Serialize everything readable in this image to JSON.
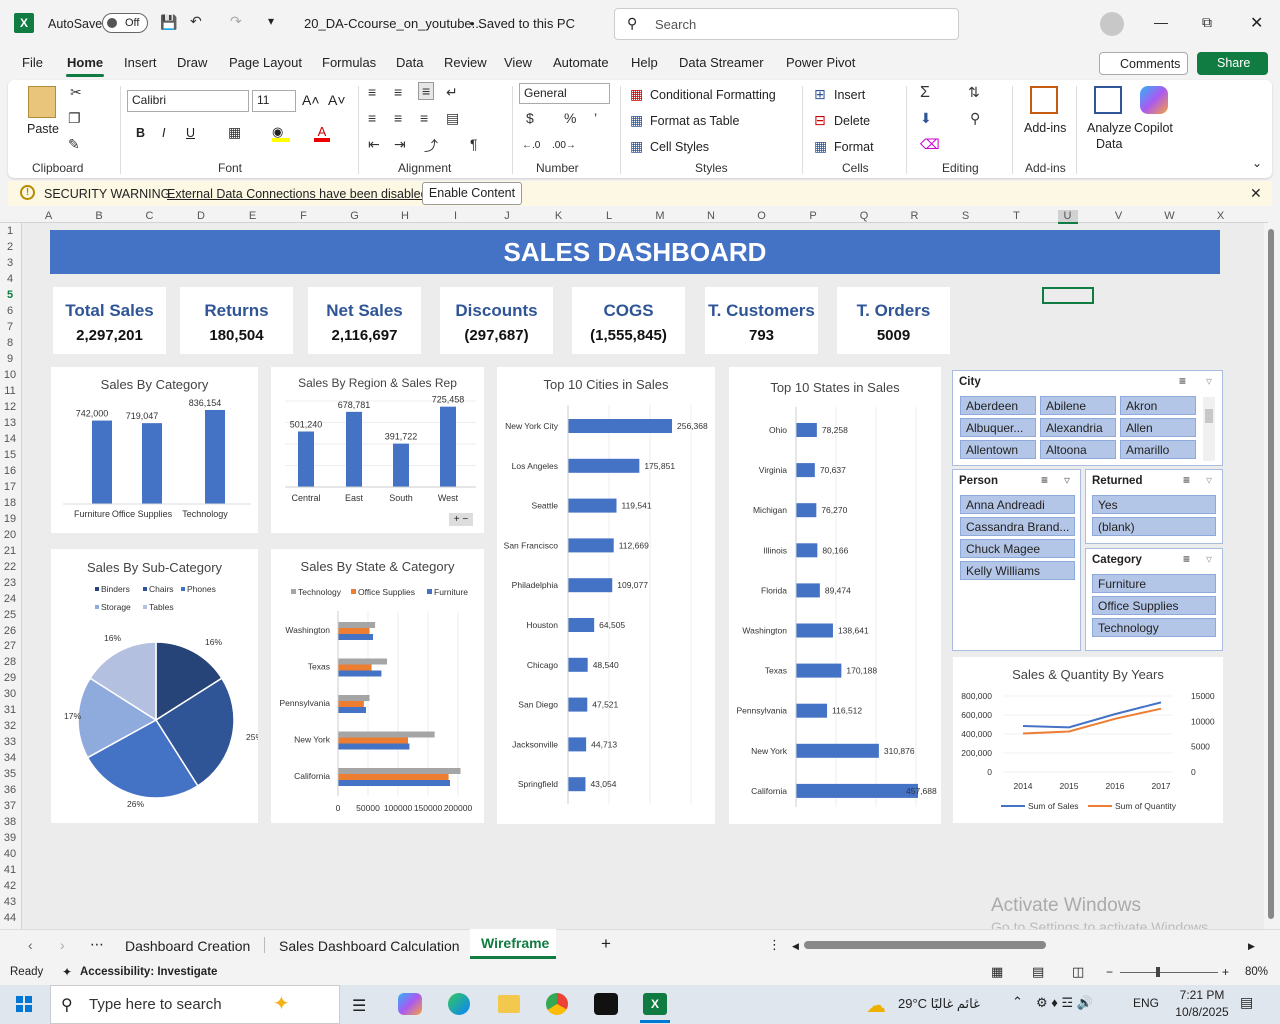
{
  "titlebar": {
    "autosave": "AutoSave",
    "toggle": "Off",
    "filename": "20_DA-Ccourse_on_youtube...",
    "saved": "• Saved to this PC",
    "search": "Search"
  },
  "menu": [
    "File",
    "Home",
    "Insert",
    "Draw",
    "Page Layout",
    "Formulas",
    "Data",
    "Review",
    "View",
    "Automate",
    "Help",
    "Data Streamer",
    "Power Pivot"
  ],
  "menu_right": {
    "comments": "Comments",
    "share": "Share"
  },
  "ribbon": {
    "paste": "Paste",
    "clipboard": "Clipboard",
    "font_name": "Calibri",
    "font_size": "11",
    "font": "Font",
    "alignment": "Alignment",
    "number_format": "General",
    "number": "Number",
    "cond_format": "Conditional Formatting",
    "format_table": "Format as Table",
    "cell_styles": "Cell Styles",
    "styles": "Styles",
    "insert": "Insert",
    "delete": "Delete",
    "format": "Format",
    "cells": "Cells",
    "editing": "Editing",
    "addins": "Add-ins",
    "addins_group": "Add-ins",
    "analyze": "Analyze",
    "analyze2": "Data",
    "copilot": "Copilot"
  },
  "security": {
    "title": "SECURITY WARNING",
    "msg": "External Data Connections have been disabled",
    "button": "Enable Content"
  },
  "columns": [
    "A",
    "B",
    "C",
    "D",
    "E",
    "F",
    "G",
    "H",
    "I",
    "J",
    "K",
    "L",
    "M",
    "N",
    "O",
    "P",
    "Q",
    "R",
    "S",
    "T",
    "U",
    "V",
    "W",
    "X"
  ],
  "rows": [
    "1",
    "2",
    "3",
    "4",
    "5",
    "6",
    "7",
    "8",
    "9",
    "10",
    "11",
    "12",
    "13",
    "14",
    "15",
    "16",
    "17",
    "18",
    "19",
    "20",
    "21",
    "22",
    "23",
    "24",
    "25",
    "26",
    "27",
    "28",
    "29",
    "30",
    "31",
    "32",
    "33",
    "34",
    "35",
    "36",
    "37",
    "38",
    "39",
    "40",
    "41",
    "42",
    "43",
    "44"
  ],
  "dashboard": {
    "title": "SALES DASHBOARD",
    "kpis": [
      {
        "label": "Total Sales",
        "value": "2,297,201"
      },
      {
        "label": "Returns",
        "value": "180,504"
      },
      {
        "label": "Net Sales",
        "value": "2,116,697"
      },
      {
        "label": "Discounts",
        "value": "(297,687)"
      },
      {
        "label": "COGS",
        "value": "(1,555,845)"
      },
      {
        "label": "T. Customers",
        "value": "793"
      },
      {
        "label": "T. Orders",
        "value": "5009"
      }
    ]
  },
  "slicers": {
    "city": {
      "title": "City",
      "items": [
        "Aberdeen",
        "Abilene",
        "Akron",
        "Albuquer...",
        "Alexandria",
        "Allen",
        "Allentown",
        "Altoona",
        "Amarillo"
      ]
    },
    "person": {
      "title": "Person",
      "items": [
        "Anna Andreadi",
        "Cassandra Brand...",
        "Chuck Magee",
        "Kelly Williams"
      ]
    },
    "returned": {
      "title": "Returned",
      "items": [
        "Yes",
        "(blank)"
      ]
    },
    "category": {
      "title": "Category",
      "items": [
        "Furniture",
        "Office Supplies",
        "Technology"
      ]
    }
  },
  "chart_data": [
    {
      "type": "bar",
      "title": "Sales By Category",
      "categories": [
        "Furniture",
        "Office Supplies",
        "Technology"
      ],
      "values": [
        742000,
        719047,
        836154
      ],
      "labels": [
        "742,000",
        "719,047",
        "836,154"
      ]
    },
    {
      "type": "bar",
      "title": "Sales By Region & Sales Rep",
      "categories": [
        "Central",
        "East",
        "South",
        "West"
      ],
      "values": [
        501240,
        678781,
        391722,
        725458
      ],
      "labels": [
        "501,240",
        "678,781",
        "391,722",
        "725,458"
      ]
    },
    {
      "type": "bar",
      "title": "Top 10 Cities in Sales",
      "categories": [
        "New York City",
        "Los Angeles",
        "Seattle",
        "San Francisco",
        "Philadelphia",
        "Houston",
        "Chicago",
        "San Diego",
        "Jacksonville",
        "Springfield"
      ],
      "values": [
        256368,
        175851,
        119541,
        112669,
        109077,
        64505,
        48540,
        47521,
        44713,
        43054
      ],
      "labels": [
        "256,368",
        "175,851",
        "119,541",
        "112,669",
        "109,077",
        "64,505",
        "48,540",
        "47,521",
        "44,713",
        "43,054"
      ]
    },
    {
      "type": "bar",
      "title": "Top 10 States in Sales",
      "categories": [
        "Ohio",
        "Virginia",
        "Michigan",
        "Illinois",
        "Florida",
        "Washington",
        "Texas",
        "Pennsylvania",
        "New York",
        "California"
      ],
      "values": [
        78258,
        70637,
        76270,
        80166,
        89474,
        138641,
        170188,
        116512,
        310876,
        457688
      ],
      "labels": [
        "78,258",
        "70,637",
        "76,270",
        "80,166",
        "89,474",
        "138,641",
        "170,188",
        "116,512",
        "310,876",
        "457,688"
      ]
    },
    {
      "type": "pie",
      "title": "Sales By Sub-Category",
      "categories": [
        "Binders",
        "Chairs",
        "Phones",
        "Storage",
        "Tables"
      ],
      "values": [
        16,
        25,
        26,
        17,
        16
      ],
      "labels": [
        "16%",
        "25%",
        "26%",
        "17%",
        "16%"
      ]
    },
    {
      "type": "bar",
      "title": "Sales By State & Category",
      "categories": [
        "Washington",
        "Texas",
        "Pennsylvania",
        "New York",
        "California"
      ],
      "series": [
        {
          "name": "Technology",
          "values": [
            53000,
            70000,
            45000,
            138000,
            175000
          ]
        },
        {
          "name": "Office Supplies",
          "values": [
            45000,
            48000,
            37000,
            100000,
            158000
          ]
        },
        {
          "name": "Furniture",
          "values": [
            50000,
            62000,
            40000,
            102000,
            160000
          ]
        }
      ],
      "xticks": [
        "0",
        "50000",
        "100000",
        "150000",
        "200000"
      ],
      "xlim": [
        0,
        250000
      ]
    },
    {
      "type": "line",
      "title": "Sales & Quantity By Years",
      "x": [
        "2014",
        "2015",
        "2016",
        "2017"
      ],
      "series": [
        {
          "name": "Sum of Sales",
          "values": [
            484000,
            470000,
            609000,
            733000
          ]
        },
        {
          "name": "Sum of Quantity",
          "values": [
            7600,
            8000,
            10500,
            12500
          ]
        }
      ],
      "y_left_ticks": [
        "800,000",
        "600,000",
        "400,000",
        "200,000",
        "0"
      ],
      "y_right_ticks": [
        "15000",
        "10000",
        "5000",
        "0"
      ]
    }
  ],
  "tabs": [
    "Dashboard Creation",
    "Sales Dashboard Calculation",
    "Wireframe"
  ],
  "status": {
    "ready": "Ready",
    "accessibility": "Accessibility: Investigate",
    "zoom": "80%"
  },
  "taskbar": {
    "search": "Type here to search",
    "weather": "29°C غائم غالبًا",
    "lang": "ENG",
    "time": "7:21 PM",
    "date": "10/8/2025"
  },
  "windows": {
    "line1": "Activate Windows",
    "line2": "Go to Settings to activate Windows."
  },
  "colors": {
    "accent": "#4472c4",
    "excel": "#107c41",
    "orange": "#ed7d31",
    "grey": "#a5a5a5"
  }
}
